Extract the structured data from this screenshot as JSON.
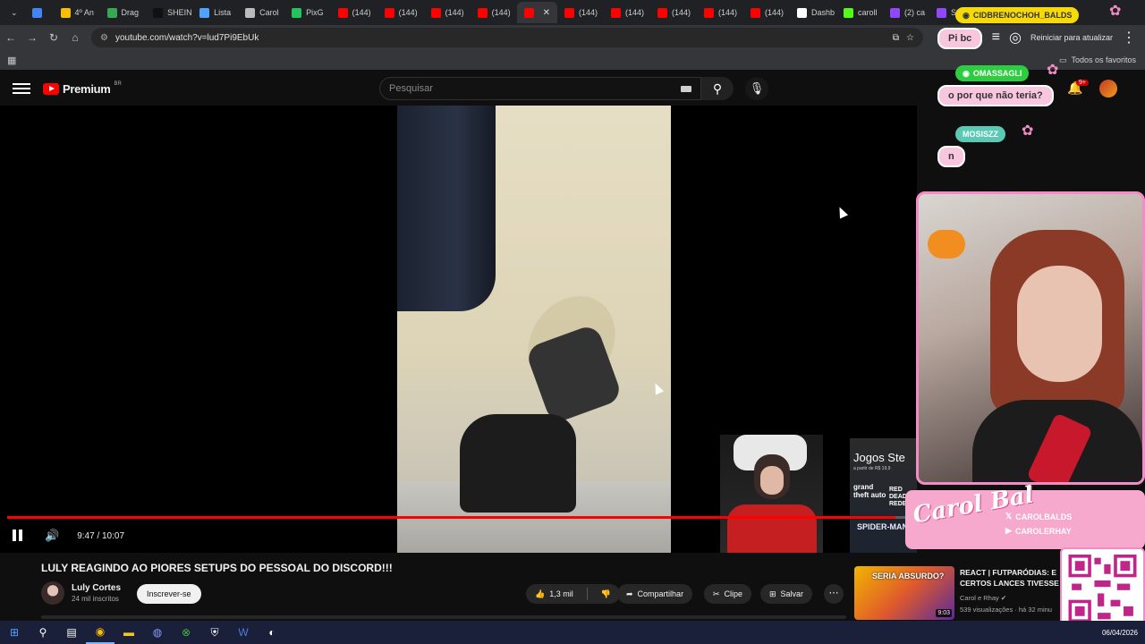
{
  "browser": {
    "tabs": [
      {
        "label": "",
        "color": "#4285f4"
      },
      {
        "label": "4º An",
        "color": "#fbbc04"
      },
      {
        "label": "Drag",
        "color": "#34a853"
      },
      {
        "label": "SHEIN",
        "color": "#111111"
      },
      {
        "label": "Lista",
        "color": "#4fa3ff"
      },
      {
        "label": "Carol",
        "color": "#bbbbbb"
      },
      {
        "label": "PixG",
        "color": "#22c55e"
      },
      {
        "label": "(144)",
        "color": "#ff0000"
      },
      {
        "label": "(144)",
        "color": "#ff0000"
      },
      {
        "label": "(144)",
        "color": "#ff0000"
      },
      {
        "label": "(144)",
        "color": "#ff0000"
      },
      {
        "label": "",
        "color": "#ff0000",
        "active": true
      },
      {
        "label": "(144)",
        "color": "#ff0000"
      },
      {
        "label": "(144)",
        "color": "#ff0000"
      },
      {
        "label": "(144)",
        "color": "#ff0000"
      },
      {
        "label": "(144)",
        "color": "#ff0000"
      },
      {
        "label": "(144)",
        "color": "#ff0000"
      },
      {
        "label": "Dashb",
        "color": "#ffffff"
      },
      {
        "label": "caroll",
        "color": "#53fc18"
      },
      {
        "label": "(2) ca",
        "color": "#9146ff"
      },
      {
        "label": "Strea",
        "color": "#9146ff"
      }
    ],
    "url": "youtube.com/watch?v=lud7Pi9EbUk",
    "restart_label": "Reiniciar para atualizar",
    "all_favorites": "Todos os favoritos"
  },
  "youtube": {
    "logo_text": "Premium",
    "region": "BR",
    "search_placeholder": "Pesquisar",
    "notification_count": "9+"
  },
  "player": {
    "progress": 0.976,
    "current_time": "9:47",
    "duration": "10:07",
    "time_separator": "/"
  },
  "ad": {
    "title": "Jogos Ste",
    "subtitle": "a partir de R$ 19,9",
    "game1": "grand theft auto",
    "game2": "RED DEAD REDEMPTION",
    "game3": "SPIDER-MAN"
  },
  "video": {
    "title": "LULY REAGINDO AO PIORES SETUPS DO PESSOAL DO DISCORD!!!",
    "channel": "Luly Cortes",
    "subscribers": "24 mil inscritos",
    "subscribe_label": "Inscrever-se",
    "likes": "1,3 mil",
    "share_label": "Compartilhar",
    "clip_label": "Clipe",
    "save_label": "Salvar"
  },
  "recommendation": {
    "thumb_text": "SERIA ABSURDO?",
    "duration": "9:03",
    "title": "REACT | FUTPARÓDIAS: E CERTOS LANCES TIVESSE",
    "channel": "Carol e Rhay",
    "stats": "539 visualizações · há 32 minu"
  },
  "stream_overlay": {
    "chat": [
      {
        "name": "CIDBRENOCHOH_BALDS",
        "message": "Pi bc",
        "name_color": "#f5d90a"
      },
      {
        "name": "OMASSAGLI",
        "message": "o por que não teria?",
        "name_color": "#2ecc40"
      },
      {
        "name": "MOSISZZ",
        "message": "n",
        "name_color": "#5cc9b5"
      }
    ],
    "brand": "Carol Bal",
    "handles": [
      {
        "icon": "x",
        "text": "CAROLBALDS"
      },
      {
        "icon": "youtube",
        "text": "CAROLERHAY"
      }
    ]
  },
  "taskbar": {
    "date": "06/04/2026"
  }
}
